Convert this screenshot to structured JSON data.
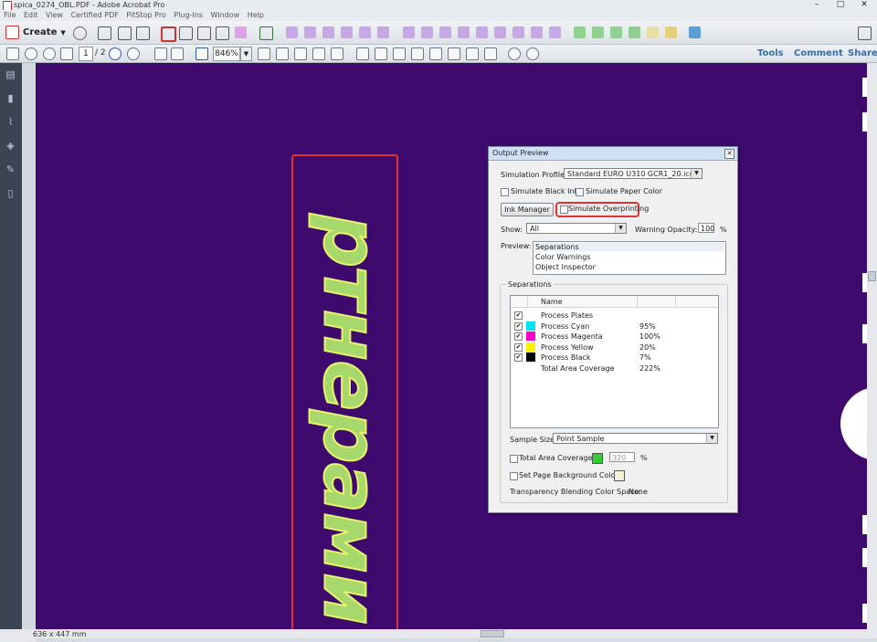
{
  "window": {
    "title": "spica_0274_OBL.PDF - Adobe Acrobat Pro",
    "controls": [
      "–",
      "□",
      "✕"
    ]
  },
  "menu": [
    "File",
    "Edit",
    "View",
    "Certified PDF",
    "PitStop Pro",
    "Plug-Ins",
    "Window",
    "Help"
  ],
  "toolbar1": {
    "create_label": "Create"
  },
  "toolbar2": {
    "page_current": "1",
    "page_total": "/ 2",
    "zoom": "846%",
    "tools": "Tools",
    "comment": "Comment",
    "share": "Share"
  },
  "document": {
    "text": "ртнерами"
  },
  "status": {
    "page_size": "636 x 447 mm"
  },
  "output_preview": {
    "title": "Output Preview",
    "simulation_profile_label": "Simulation Profile:",
    "simulation_profile_value": "Standard EURO U310 GCR1_20.icc",
    "simulate_black_ink": "Simulate Black Ink",
    "simulate_paper_color": "Simulate Paper Color",
    "ink_manager": "Ink Manager",
    "simulate_overprinting": "Simulate Overprinting",
    "show_label": "Show:",
    "show_value": "All",
    "warning_opacity_label": "Warning Opacity:",
    "warning_opacity_value": "100",
    "warning_opacity_unit": "%",
    "preview_label": "Preview:",
    "preview_options": [
      "Separations",
      "Color Warnings",
      "Object Inspector"
    ],
    "separations_label": "Separations",
    "column_name": "Name",
    "separations": [
      {
        "name": "Process Plates",
        "checked": true,
        "color": "",
        "value": ""
      },
      {
        "name": "Process Cyan",
        "checked": true,
        "color": "#00e5f5",
        "value": "95%"
      },
      {
        "name": "Process Magenta",
        "checked": true,
        "color": "#ff00cc",
        "value": "100%"
      },
      {
        "name": "Process Yellow",
        "checked": true,
        "color": "#fff200",
        "value": "20%"
      },
      {
        "name": "Process Black",
        "checked": true,
        "color": "#000000",
        "value": "7%"
      },
      {
        "name": "Total Area Coverage",
        "checked": false,
        "color": "",
        "value": "222%"
      }
    ],
    "sample_size_label": "Sample Size:",
    "sample_size_value": "Point Sample",
    "total_area_coverage_label": "Total Area Coverage",
    "total_area_coverage_value": "320",
    "total_area_coverage_unit": "%",
    "set_page_background_label": "Set Page Background Color",
    "transparency_label": "Transparency Blending Color Space:",
    "transparency_value": "None"
  },
  "colors": {
    "page_background": "#3e0a6e",
    "text_fill": "#a7d86c",
    "highlight": "#e23131"
  }
}
